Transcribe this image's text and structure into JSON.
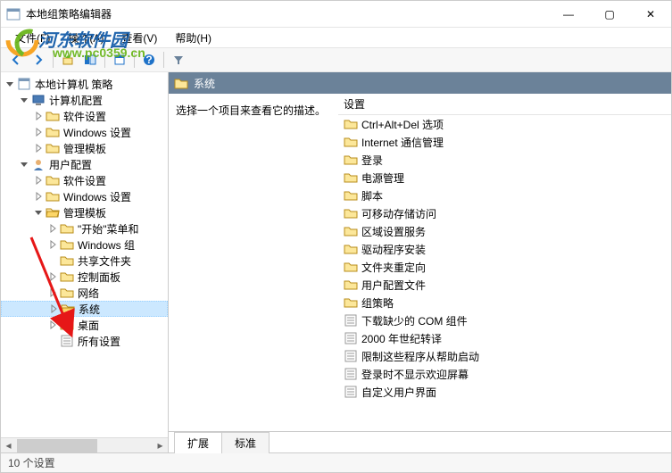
{
  "window": {
    "title": "本地组策略编辑器",
    "minimize": "—",
    "maximize": "▢",
    "close": "✕"
  },
  "menu": {
    "file": "文件(F)",
    "action": "操作(A)",
    "view": "查看(V)",
    "help": "帮助(H)"
  },
  "tree": {
    "root": "本地计算机 策略",
    "computer": "计算机配置",
    "c_soft": "软件设置",
    "c_win": "Windows 设置",
    "c_admin": "管理模板",
    "user": "用户配置",
    "u_soft": "软件设置",
    "u_win": "Windows 设置",
    "u_admin": "管理模板",
    "start": "\"开始\"菜单和",
    "wincomp": "Windows 组",
    "shared": "共享文件夹",
    "control": "控制面板",
    "network": "网络",
    "system": "系统",
    "desktop": "桌面",
    "allset": "所有设置"
  },
  "header": {
    "title": "系统"
  },
  "desc": {
    "text": "选择一个项目来查看它的描述。"
  },
  "list": {
    "header": "设置",
    "items": [
      {
        "t": "folder",
        "label": "Ctrl+Alt+Del 选项"
      },
      {
        "t": "folder",
        "label": "Internet 通信管理"
      },
      {
        "t": "folder",
        "label": "登录"
      },
      {
        "t": "folder",
        "label": "电源管理"
      },
      {
        "t": "folder",
        "label": "脚本"
      },
      {
        "t": "folder",
        "label": "可移动存储访问"
      },
      {
        "t": "folder",
        "label": "区域设置服务"
      },
      {
        "t": "folder",
        "label": "驱动程序安装"
      },
      {
        "t": "folder",
        "label": "文件夹重定向"
      },
      {
        "t": "folder",
        "label": "用户配置文件"
      },
      {
        "t": "folder",
        "label": "组策略"
      },
      {
        "t": "setting",
        "label": "下载缺少的 COM 组件"
      },
      {
        "t": "setting",
        "label": "2000 年世纪转译"
      },
      {
        "t": "setting",
        "label": "限制这些程序从帮助启动"
      },
      {
        "t": "setting",
        "label": "登录时不显示欢迎屏幕"
      },
      {
        "t": "setting",
        "label": "自定义用户界面"
      }
    ]
  },
  "tabs": {
    "extended": "扩展",
    "standard": "标准"
  },
  "status": {
    "text": "10 个设置"
  },
  "watermark": {
    "line1": "河东软件园",
    "line2": "www.pc0359.cn"
  }
}
